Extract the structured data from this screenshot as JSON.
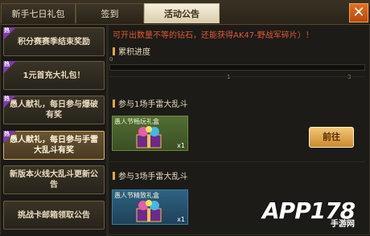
{
  "tabs": [
    {
      "label": "新手七日礼包"
    },
    {
      "label": "签到"
    },
    {
      "label": "活动公告"
    }
  ],
  "sidebar": {
    "hot_badge": "热",
    "items": [
      {
        "label": "积分赛赛季结束奖励"
      },
      {
        "label": "1元首充大礼包！"
      },
      {
        "label": "愚人献礼，每日参与爆破有奖"
      },
      {
        "label": "愚人献礼，每日参与手雷大乱斗有奖"
      },
      {
        "label": "新版本火线大乱斗更新公告"
      },
      {
        "label": "挑战卡邮箱领取公告"
      }
    ]
  },
  "content": {
    "notice": "可开出数量不等的钻石，还能获得AK47-野战军碎片）！",
    "progress_title": "累积进度",
    "progress": {
      "value": 0,
      "ticks": [
        "0",
        "1",
        "3"
      ]
    },
    "task1": {
      "title": "参与1场手雷大乱斗",
      "reward_name": "愚人节畅玩礼盒",
      "qty": "x1",
      "button": "前往"
    },
    "task2": {
      "title": "参与3场手雷大乱斗",
      "reward_name": "愚人节精致礼盒",
      "qty": "x1"
    }
  },
  "watermark": {
    "text": "APP178",
    "sub": "手游网"
  },
  "colors": {
    "accent": "#e3a739",
    "notice": "#e05a2c",
    "close": "#d25d14"
  }
}
